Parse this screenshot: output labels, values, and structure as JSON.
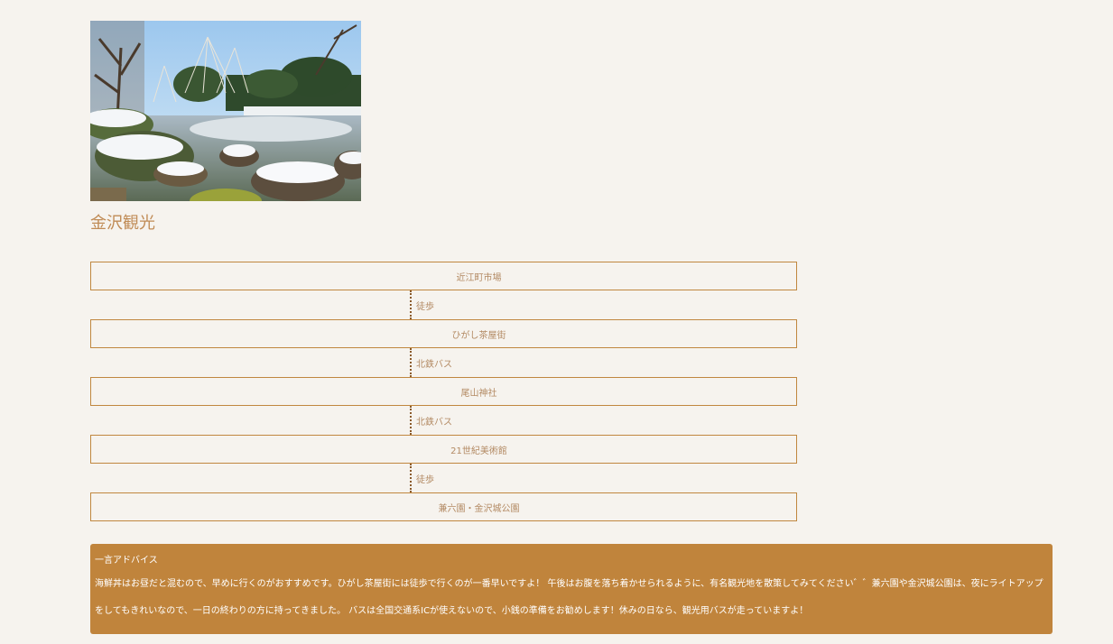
{
  "spot": {
    "title": "金沢観光",
    "image_alt": "兼六園の雪景色"
  },
  "route": {
    "stops": [
      "近江町市場",
      "ひがし茶屋街",
      "尾山神社",
      "21世紀美術館",
      "兼六園・金沢城公園"
    ],
    "legs": [
      "徒歩",
      "北鉄バス",
      "北鉄バス",
      "徒歩"
    ]
  },
  "advice": {
    "title": "一言アドバイス",
    "text": "海鮮丼はお昼だと混むので、早めに行くのがおすすめです。ひがし茶屋街には徒歩で行くのが一番早いですよ！ 午後はお腹を落ち着かせられるように、有名観光地を散策してみてください゛゛兼六園や金沢城公園は、夜にライトアップをしてもきれいなので、一日の終わりの方に持ってきました。 バスは全国交通系ICが使えないので、小銭の準備をお勧めします！休みの日なら、観光用バスが走っていますよ！"
  },
  "colors": {
    "background": "#f6f3ee",
    "accent": "#c0843c",
    "text_muted": "#b38a63"
  }
}
